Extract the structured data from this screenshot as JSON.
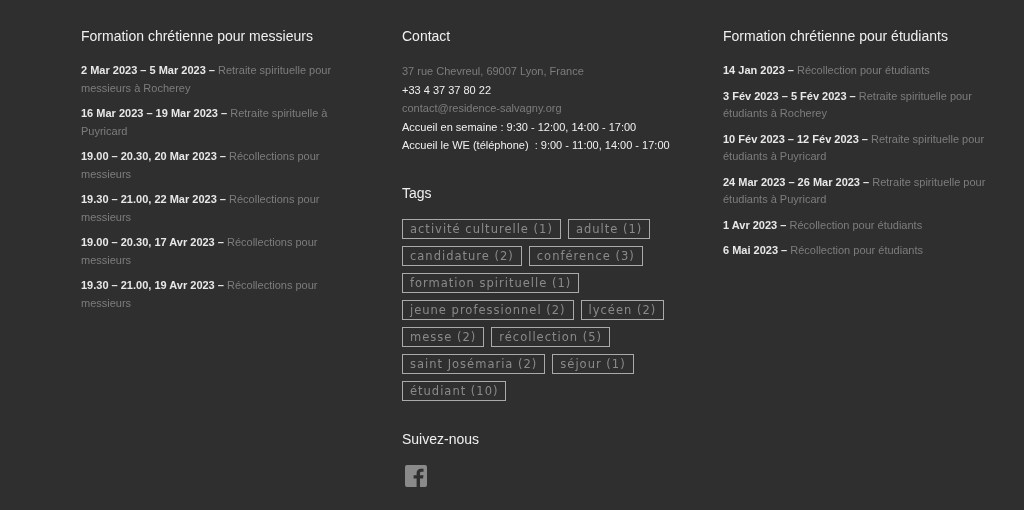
{
  "columns": [
    {
      "title": "Formation chrétienne pour messieurs",
      "events": [
        {
          "date": "2 Mar 2023 – 5 Mar 2023 –",
          "title": "Retraite spirituelle pour messieurs à Rocherey"
        },
        {
          "date": "16 Mar 2023 – 19 Mar 2023 –",
          "title": "Retraite spirituelle à Puyricard"
        },
        {
          "date": "19.00 – 20.30, 20 Mar 2023 –",
          "title": "Récollections pour messieurs"
        },
        {
          "date": "19.30 – 21.00, 22 Mar 2023 –",
          "title": "Récollections pour messieurs"
        },
        {
          "date": "19.00 – 20.30, 17 Avr 2023 –",
          "title": "Récollections pour messieurs"
        },
        {
          "date": "19.30 – 21.00, 19 Avr 2023 –",
          "title": "Récollections pour messieurs"
        }
      ]
    },
    {
      "title": "Formation chrétienne pour étudiants",
      "events": [
        {
          "date": "14 Jan 2023 –",
          "title": "Récollection pour étudiants"
        },
        {
          "date": "3 Fév 2023 – 5 Fév 2023 –",
          "title": "Retraite spirituelle pour étudiants à Rocherey"
        },
        {
          "date": "10 Fév 2023 – 12 Fév 2023 –",
          "title": "Retraite spirituelle pour étudiants à Puyricard"
        },
        {
          "date": "24 Mar 2023 – 26 Mar 2023 –",
          "title": "Retraite spirituelle pour étudiants à Puyricard"
        },
        {
          "date": "1 Avr 2023 –",
          "title": "Récollection pour étudiants"
        },
        {
          "date": "6 Mai 2023 –",
          "title": "Récollection pour étudiants"
        }
      ]
    }
  ],
  "contact": {
    "title": "Contact",
    "lines": [
      {
        "kind": "address",
        "text": "37 rue Chevreul, 69007 Lyon, France"
      },
      {
        "kind": "phone",
        "text": "+33 4 37 37 80 22"
      },
      {
        "kind": "email",
        "text": "contact@residence-salvagny.org"
      },
      {
        "kind": "hours",
        "text": "Accueil en semaine : 9:30 - 12:00, 14:00 - 17:00"
      },
      {
        "kind": "hours",
        "text": "Accueil le WE (téléphone)  : 9:00 - 11:00, 14:00 - 17:00"
      }
    ]
  },
  "tags": {
    "title": "Tags",
    "items": [
      "activité culturelle (1)",
      "adulte (1)",
      "candidature (2)",
      "conférence (3)",
      "formation spirituelle (1)",
      "jeune professionnel (2)",
      "lycéen (2)",
      "messe (2)",
      "récollection (5)",
      "saint Josémaria (2)",
      "séjour (1)",
      "étudiant (10)"
    ]
  },
  "social": {
    "title": "Suivez-nous"
  }
}
